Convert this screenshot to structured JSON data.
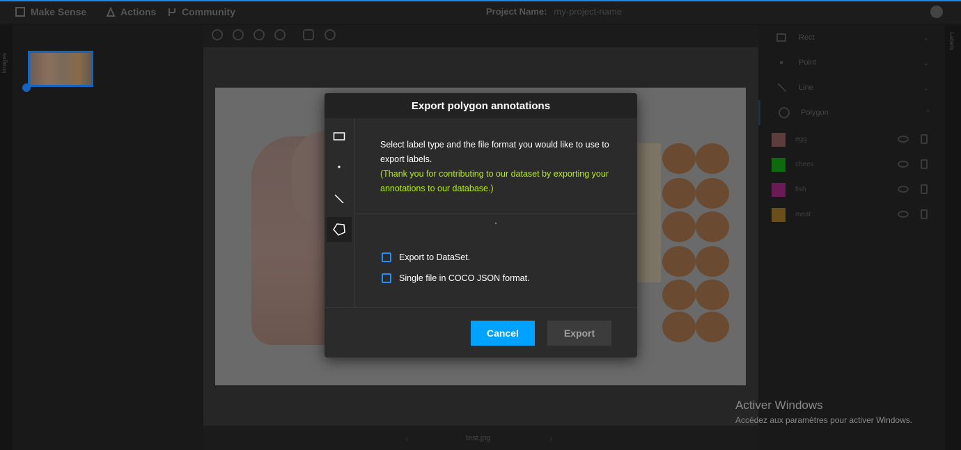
{
  "topbar": {
    "brand": "Make Sense",
    "actions": "Actions",
    "community": "Community",
    "project_label": "Project Name:",
    "project_name": "my-project-name"
  },
  "left_tab": {
    "label": "Images"
  },
  "right_tab": {
    "label": "Labels"
  },
  "label_types": [
    {
      "name": "Rect"
    },
    {
      "name": "Point"
    },
    {
      "name": "Line"
    },
    {
      "name": "Polygon"
    }
  ],
  "labels": [
    {
      "name": "egg",
      "color": "#5c3c3c"
    },
    {
      "name": "chees",
      "color": "#0e6a0e"
    },
    {
      "name": "fish",
      "color": "#6a1a55"
    },
    {
      "name": "meat",
      "color": "#6a4f1a"
    }
  ],
  "editor": {
    "file_name": "test.jpg",
    "prev_arrow": "‹",
    "next_arrow": "›"
  },
  "modal": {
    "title": "Export polygon annotations",
    "message": "Select label type and the file format you would like to use to export labels.",
    "note": "(Thank you for contributing to our dataset by exporting your annotations to our database.)",
    "options": [
      "Export to DataSet.",
      "Single file in COCO JSON format."
    ],
    "cancel": "Cancel",
    "export": "Export"
  },
  "watermark": {
    "title": "Activer Windows",
    "subtitle": "Accédez aux paramètres pour activer Windows."
  }
}
